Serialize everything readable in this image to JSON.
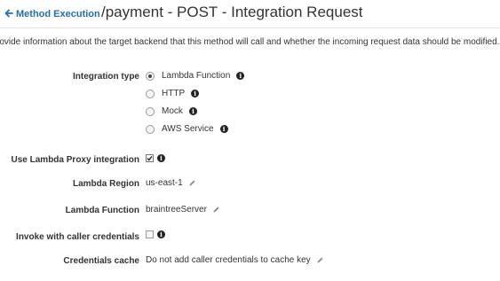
{
  "header": {
    "back_label": "Method Execution",
    "title": "/payment - POST - Integration Request"
  },
  "description": "rovide information about the target backend that this method will call and whether the incoming request data should be modified.",
  "integration_type": {
    "label": "Integration type",
    "selected": "Lambda Function",
    "options": [
      {
        "label": "Lambda Function",
        "checked": true
      },
      {
        "label": "HTTP",
        "checked": false
      },
      {
        "label": "Mock",
        "checked": false
      },
      {
        "label": "AWS Service",
        "checked": false
      }
    ]
  },
  "lambda_proxy": {
    "label": "Use Lambda Proxy integration",
    "checked": true
  },
  "lambda_region": {
    "label": "Lambda Region",
    "value": "us-east-1"
  },
  "lambda_function": {
    "label": "Lambda Function",
    "value": "braintreeServer"
  },
  "invoke_credentials": {
    "label": "Invoke with caller credentials",
    "checked": false
  },
  "credentials_cache": {
    "label": "Credentials cache",
    "value": "Do not add caller credentials to cache key"
  },
  "icons": {
    "back": "arrow-left-icon",
    "info": "info-icon",
    "edit": "pencil-icon"
  },
  "colors": {
    "link": "#1f6fb5",
    "text": "#333333",
    "divider": "#e4e4e4"
  }
}
